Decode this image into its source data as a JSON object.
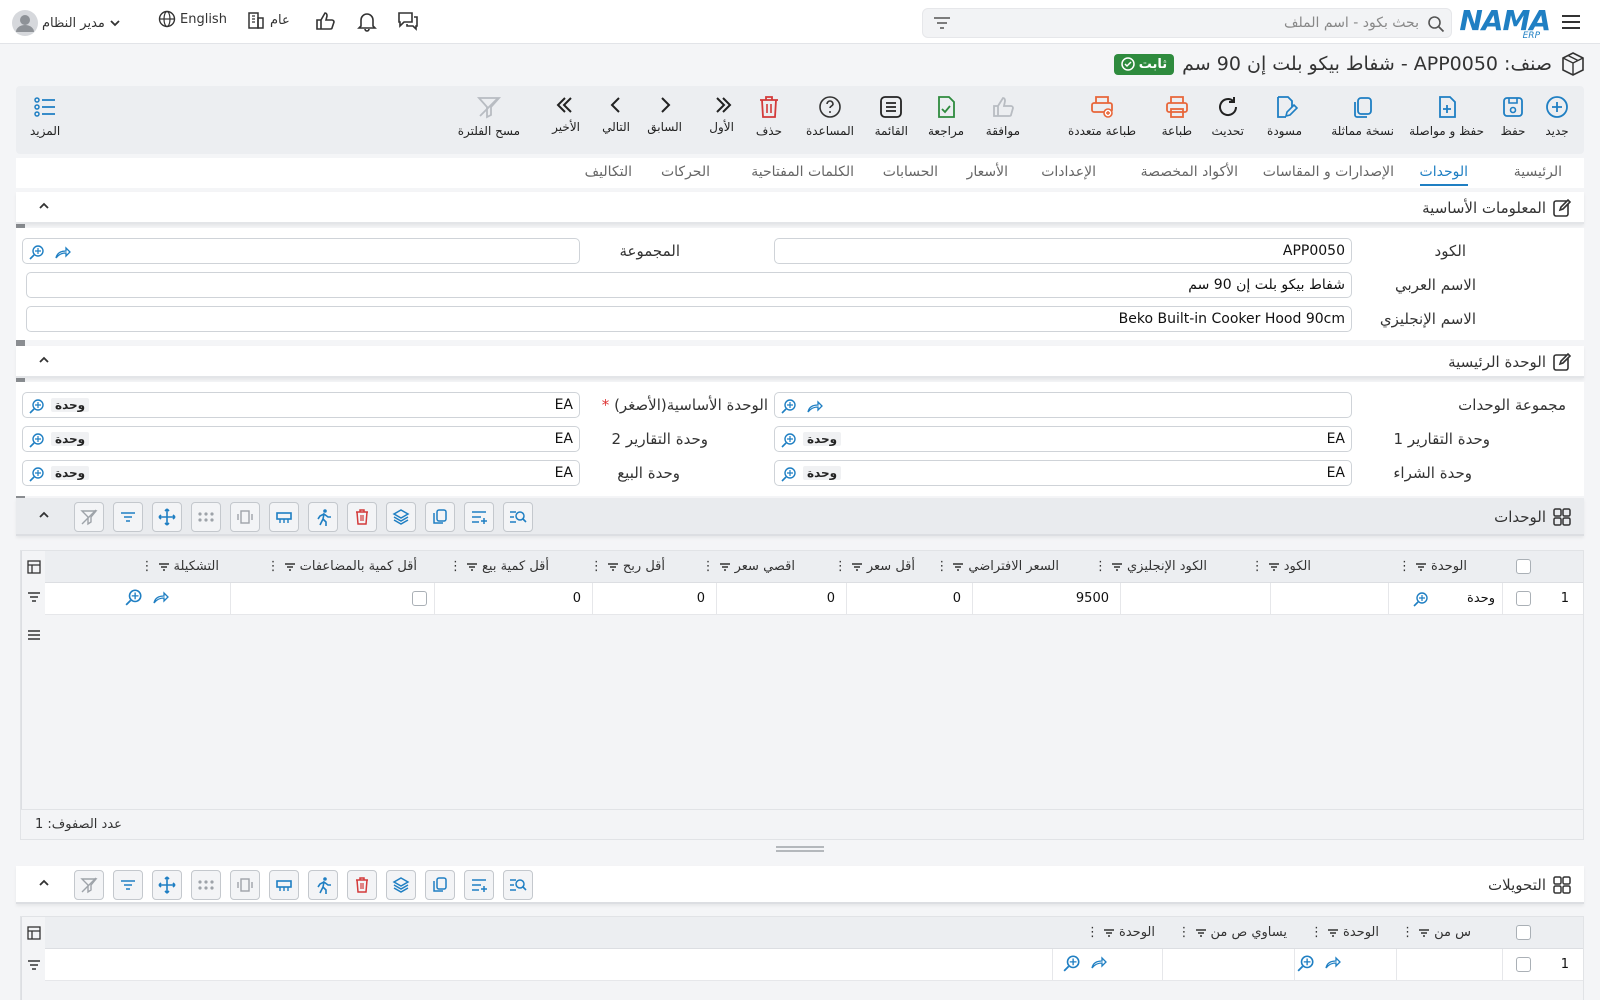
{
  "topbar": {
    "logo": "NAMA",
    "logo_sub": "ERP",
    "search_placeholder": "بحث بكود - اسم الملف",
    "user": "مدير النظام",
    "language": "English",
    "company": "عام"
  },
  "title": {
    "text": "صنف: APP0050 - شفاط بيكو بلت إن 90 سم",
    "badge": "ثابت"
  },
  "toolbar": {
    "new": "جديد",
    "save": "حفظ",
    "save_continue": "حفظ و مواصلة",
    "duplicate": "نسخة مماثلة",
    "draft": "مسودة",
    "refresh": "تحديث",
    "print": "طباعة",
    "multi_print": "طباعة متعددة",
    "approve": "موافقة",
    "review": "مراجعة",
    "list": "القائمة",
    "help": "المساعدة",
    "delete": "حذف",
    "first": "الأول",
    "previous": "السابق",
    "next": "التالي",
    "last": "الأخير",
    "clear_filter": "مسح الفلترة",
    "more": "المزيد"
  },
  "tabs": [
    "الرئيسية",
    "الوحدات",
    "الإصدارات و المقاسات",
    "الأكواد المخصصة",
    "الإعدادات",
    "الأسعار",
    "الحسابات",
    "الكلمات المفتاحية",
    "الحركات",
    "التكاليف"
  ],
  "basic": {
    "title": "المعلومات الأساسية",
    "code_label": "الكود",
    "code_value": "APP0050",
    "group_label": "المجموعة",
    "arabic_label": "الاسم العربي",
    "arabic_value": "شفاط بيكو بلت إن 90 سم",
    "english_label": "الاسم الإنجليزي",
    "english_value": "Beko Built-in Cooker Hood 90cm"
  },
  "main_unit": {
    "title": "الوحدة الرئيسية",
    "units_group_label": "مجموعة الوحدات",
    "base_unit_label": "الوحدة الأساسية(الأصغر)",
    "report1_label": "وحدة التقارير 1",
    "report2_label": "وحدة التقارير 2",
    "purchase_label": "وحدة الشراء",
    "sale_label": "وحدة البيع",
    "unit_code": "EA",
    "unit_name": "وحدة"
  },
  "units_grid": {
    "title": "الوحدات",
    "columns": [
      "الوحدة",
      "الكود",
      "الكود الإنجليزي",
      "السعر الافتراضي",
      "أقل سعر",
      "اقصي سعر",
      "أقل ربح",
      "أقل كمية بيع",
      "أقل كمية بالمضاعفات",
      "التشكيلة"
    ],
    "rows": [
      {
        "num": "1",
        "unit": "وحدة",
        "code": "",
        "en_code": "",
        "default_price": "9500",
        "min_price": "0",
        "max_price": "0",
        "min_profit": "0",
        "min_qty": "0"
      }
    ],
    "row_count": "عدد الصفوف: 1"
  },
  "conversions_grid": {
    "title": "التحويلات",
    "columns": [
      "س من",
      "الوحدة",
      "يساوي ص من",
      "الوحدة"
    ],
    "rows": [
      {
        "num": "1"
      }
    ]
  },
  "colors": {
    "accent": "#1f7fc3",
    "badge": "#2e8b3e",
    "danger": "#d33a3a"
  }
}
